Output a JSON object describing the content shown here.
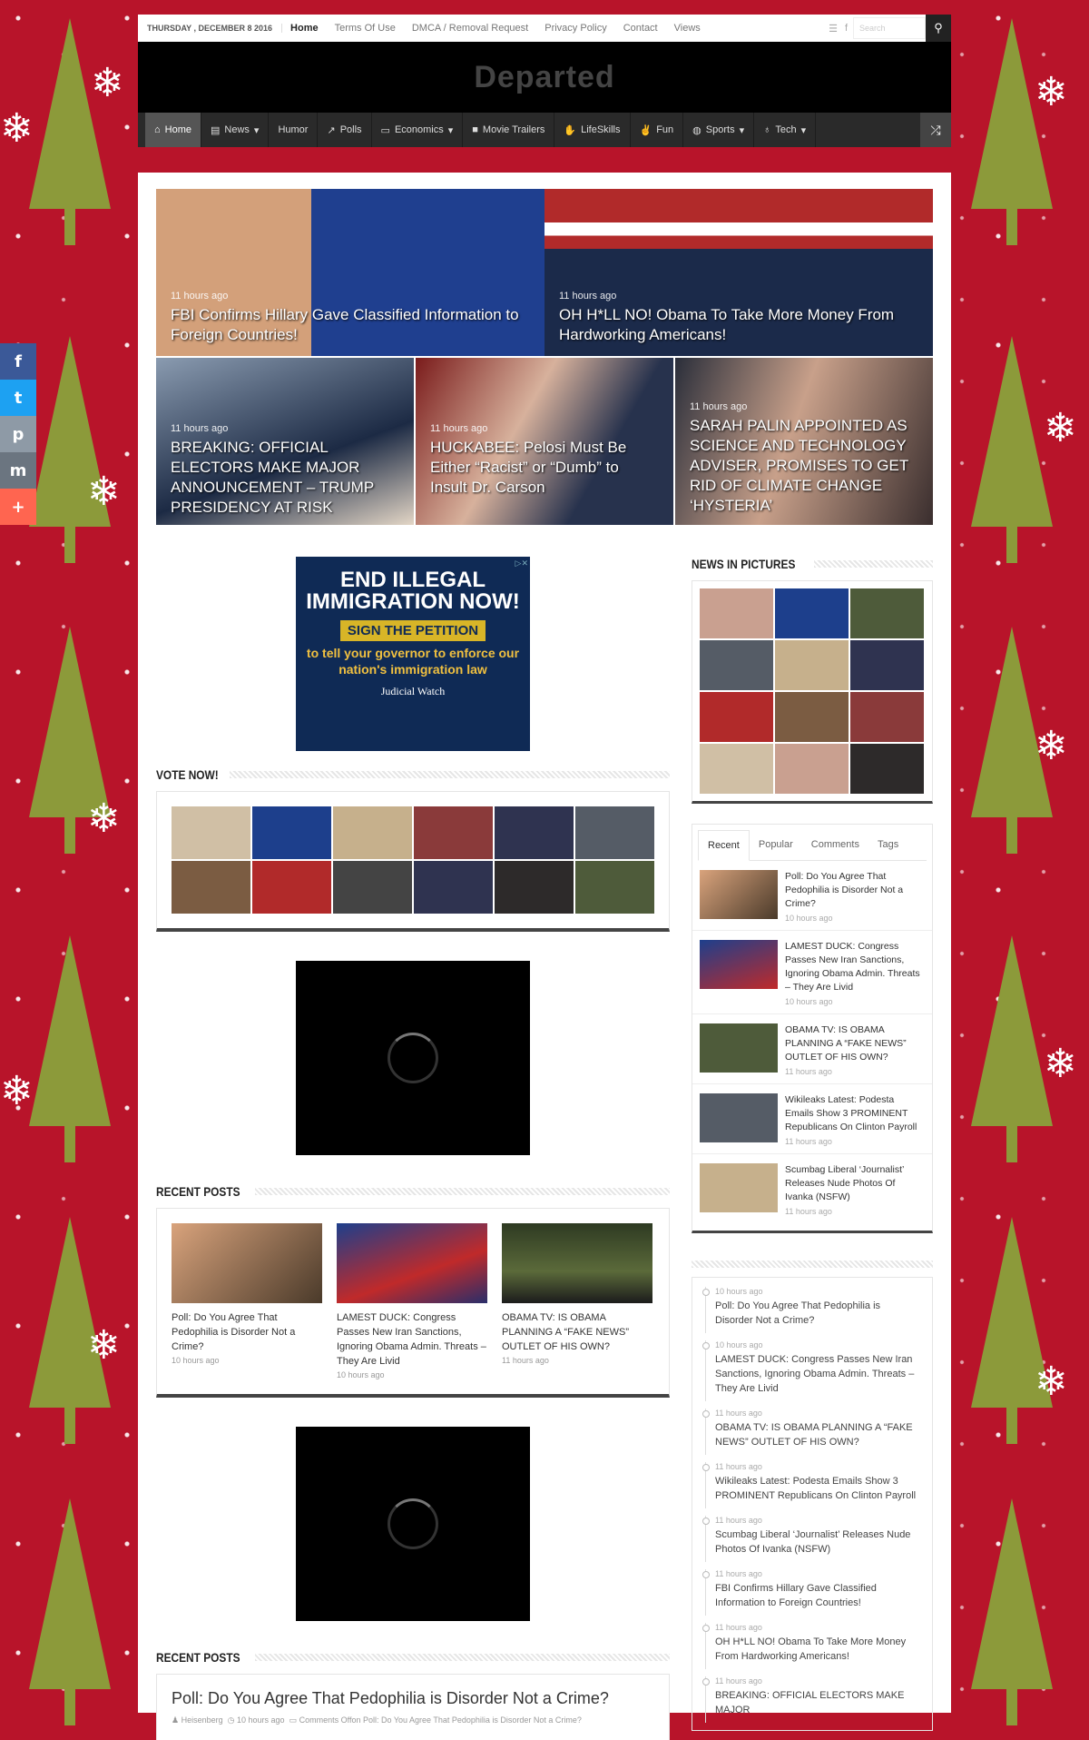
{
  "topbar": {
    "date": "THURSDAY , DECEMBER 8 2016",
    "links": [
      "Home",
      "Terms Of Use",
      "DMCA / Removal Request",
      "Privacy Policy",
      "Contact",
      "Views"
    ],
    "search_placeholder": "Search"
  },
  "site": {
    "logo": "Departed"
  },
  "nav": {
    "items": [
      "Home",
      "News",
      "Humor",
      "Polls",
      "Economics",
      "Movie Trailers",
      "LifeSkills",
      "Fun",
      "Sports",
      "Tech"
    ]
  },
  "share": [
    "f",
    "t",
    "p",
    "m",
    "+"
  ],
  "slider": [
    {
      "time": "11 hours ago",
      "title": "FBI Confirms Hillary Gave Classified Information to Foreign Countries!"
    },
    {
      "time": "11 hours ago",
      "title": "OH H*LL NO! Obama To Take More Money From Hardworking Americans!"
    },
    {
      "time": "11 hours ago",
      "title": "BREAKING: OFFICIAL ELECTORS MAKE MAJOR ANNOUNCEMENT – TRUMP PRESIDENCY AT RISK"
    },
    {
      "time": "11 hours ago",
      "title": "HUCKABEE: Pelosi Must Be Either “Racist” or “Dumb” to Insult Dr. Carson"
    },
    {
      "time": "11 hours ago",
      "title": "SARAH PALIN APPOINTED AS SCIENCE AND TECHNOLOGY ADVISER, PROMISES TO GET RID OF CLIMATE CHANGE ‘HYSTERIA’"
    }
  ],
  "ad": {
    "headline": "END ILLEGAL IMMIGRATION NOW!",
    "button": "SIGN THE PETITION",
    "sub": "to tell your governor to enforce our nation's immigration law",
    "brand": "Judicial Watch"
  },
  "vote": {
    "heading": "VOTE NOW!"
  },
  "recent_posts": {
    "heading": "RECENT POSTS",
    "items": [
      {
        "title": "Poll: Do You Agree That Pedophilia is Disorder Not a Crime?",
        "time": "10 hours ago"
      },
      {
        "title": "LAMEST DUCK: Congress Passes New Iran Sanctions, Ignoring Obama Admin. Threats – They Are Livid",
        "time": "10 hours ago"
      },
      {
        "title": "OBAMA TV: IS OBAMA PLANNING A “FAKE NEWS” OUTLET OF HIS OWN?",
        "time": "11 hours ago"
      }
    ]
  },
  "recent_posts_2": {
    "heading": "RECENT POSTS",
    "title": "Poll: Do You Agree That Pedophilia is Disorder Not a Crime?",
    "author": "Heisenberg",
    "time": "10 hours ago",
    "comments": "Comments Offon Poll: Do You Agree That Pedophilia is Disorder Not a Crime?"
  },
  "sidebar": {
    "news_in_pictures": "NEWS IN PICTURES",
    "tabs": [
      "Recent",
      "Popular",
      "Comments",
      "Tags"
    ],
    "tab_items": [
      {
        "title": "Poll: Do You Agree That Pedophilia is Disorder Not a Crime?",
        "time": "10 hours ago"
      },
      {
        "title": "LAMEST DUCK: Congress Passes New Iran Sanctions, Ignoring Obama Admin. Threats – They Are Livid",
        "time": "10 hours ago"
      },
      {
        "title": "OBAMA TV: IS OBAMA PLANNING A “FAKE NEWS” OUTLET OF HIS OWN?",
        "time": "11 hours ago"
      },
      {
        "title": "Wikileaks Latest: Podesta Emails Show 3 PROMINENT Republicans On Clinton Payroll",
        "time": "11 hours ago"
      },
      {
        "title": "Scumbag Liberal ‘Journalist’ Releases Nude Photos Of Ivanka (NSFW)",
        "time": "11 hours ago"
      }
    ],
    "timeline": [
      {
        "time": "10 hours ago",
        "title": "Poll: Do You Agree That Pedophilia is Disorder Not a Crime?"
      },
      {
        "time": "10 hours ago",
        "title": "LAMEST DUCK: Congress Passes New Iran Sanctions, Ignoring Obama Admin. Threats – They Are Livid"
      },
      {
        "time": "11 hours ago",
        "title": "OBAMA TV: IS OBAMA PLANNING A “FAKE NEWS” OUTLET OF HIS OWN?"
      },
      {
        "time": "11 hours ago",
        "title": "Wikileaks Latest: Podesta Emails Show 3 PROMINENT Republicans On Clinton Payroll"
      },
      {
        "time": "11 hours ago",
        "title": "Scumbag Liberal ‘Journalist’ Releases Nude Photos Of Ivanka (NSFW)"
      },
      {
        "time": "11 hours ago",
        "title": "FBI Confirms Hillary Gave Classified Information to Foreign Countries!"
      },
      {
        "time": "11 hours ago",
        "title": "OH H*LL NO! Obama To Take More Money From Hardworking Americans!"
      },
      {
        "time": "11 hours ago",
        "title": "BREAKING: OFFICIAL ELECTORS MAKE MAJOR"
      }
    ]
  },
  "colors": {
    "background": "#b8142a",
    "nav": "#2a2a2a",
    "tree": "#8c9a3a"
  }
}
